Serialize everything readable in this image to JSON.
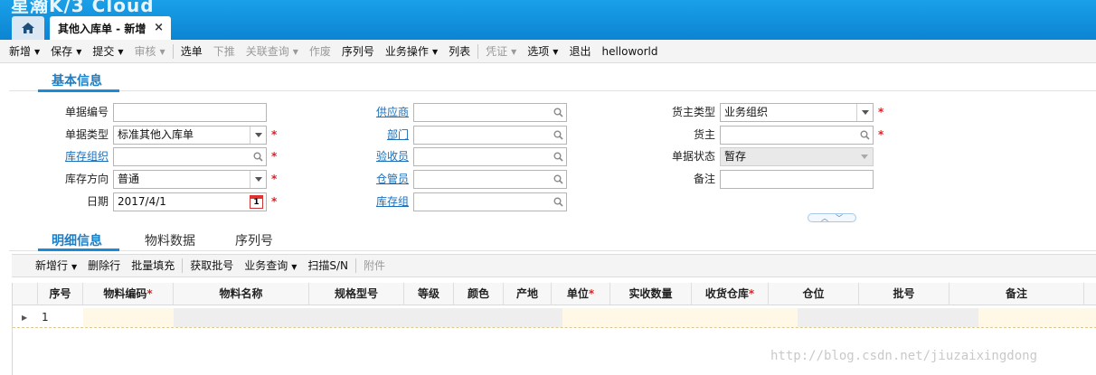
{
  "app": {
    "brand": "星瀚K/3 Cloud"
  },
  "tabs": {
    "doc_tab_label": "其他入库单 - 新增"
  },
  "toolbar": {
    "items": [
      {
        "label": "新增",
        "dropdown": true,
        "disabled": false
      },
      {
        "label": "保存",
        "dropdown": true,
        "disabled": false
      },
      {
        "label": "提交",
        "dropdown": true,
        "disabled": false
      },
      {
        "label": "审核",
        "dropdown": true,
        "disabled": true
      },
      {
        "label": "选单",
        "dropdown": false,
        "disabled": false
      },
      {
        "label": "下推",
        "dropdown": false,
        "disabled": true
      },
      {
        "label": "关联查询",
        "dropdown": true,
        "disabled": true
      },
      {
        "label": "作废",
        "dropdown": false,
        "disabled": true
      },
      {
        "label": "序列号",
        "dropdown": false,
        "disabled": false
      },
      {
        "label": "业务操作",
        "dropdown": true,
        "disabled": false
      },
      {
        "label": "列表",
        "dropdown": false,
        "disabled": false
      },
      {
        "label": "凭证",
        "dropdown": true,
        "disabled": true
      },
      {
        "label": "选项",
        "dropdown": true,
        "disabled": false
      },
      {
        "label": "退出",
        "dropdown": false,
        "disabled": false
      },
      {
        "label": "helloworld",
        "dropdown": false,
        "disabled": false
      }
    ]
  },
  "basic": {
    "section_title": "基本信息",
    "bill_no_label": "单据编号",
    "bill_no_value": "",
    "bill_type_label": "单据类型",
    "bill_type_value": "标准其他入库单",
    "stock_org_label": "库存组织",
    "stock_org_value": "",
    "stock_direction_label": "库存方向",
    "stock_direction_value": "普通",
    "date_label": "日期",
    "date_value": "2017/4/1",
    "date_icon_day": "1",
    "supplier_label": "供应商",
    "supplier_value": "",
    "dept_label": "部门",
    "dept_value": "",
    "acceptor_label": "验收员",
    "acceptor_value": "",
    "stocker_label": "仓管员",
    "stocker_value": "",
    "stock_group_label": "库存组",
    "stock_group_value": "",
    "owner_type_label": "货主类型",
    "owner_type_value": "业务组织",
    "owner_label": "货主",
    "owner_value": "",
    "status_label": "单据状态",
    "status_value": "暂存",
    "remark_label": "备注",
    "remark_value": ""
  },
  "detail_tabs": [
    "明细信息",
    "物料数据",
    "序列号"
  ],
  "detail_toolbar": [
    {
      "label": "新增行",
      "dropdown": true,
      "disabled": false
    },
    {
      "label": "删除行",
      "dropdown": false,
      "disabled": false
    },
    {
      "label": "批量填充",
      "dropdown": false,
      "disabled": false
    },
    {
      "label": "获取批号",
      "dropdown": false,
      "disabled": false
    },
    {
      "label": "业务查询",
      "dropdown": true,
      "disabled": false
    },
    {
      "label": "扫描S/N",
      "dropdown": false,
      "disabled": false
    },
    {
      "label": "附件",
      "dropdown": false,
      "disabled": true
    }
  ],
  "grid": {
    "columns": [
      {
        "label": "序号",
        "required": false
      },
      {
        "label": "物料编码",
        "required": true
      },
      {
        "label": "物料名称",
        "required": false
      },
      {
        "label": "规格型号",
        "required": false
      },
      {
        "label": "等级",
        "required": false
      },
      {
        "label": "颜色",
        "required": false
      },
      {
        "label": "产地",
        "required": false
      },
      {
        "label": "单位",
        "required": true
      },
      {
        "label": "实收数量",
        "required": false
      },
      {
        "label": "收货仓库",
        "required": true
      },
      {
        "label": "仓位",
        "required": false
      },
      {
        "label": "批号",
        "required": false
      },
      {
        "label": "备注",
        "required": false
      }
    ],
    "rows": [
      {
        "seq": "1"
      }
    ]
  },
  "watermark": "http://blog.csdn.net/jiuzaixingdong",
  "colors": {
    "accent": "#1a8bd6",
    "required": "#e02020",
    "topbar": "#0c84d2"
  }
}
